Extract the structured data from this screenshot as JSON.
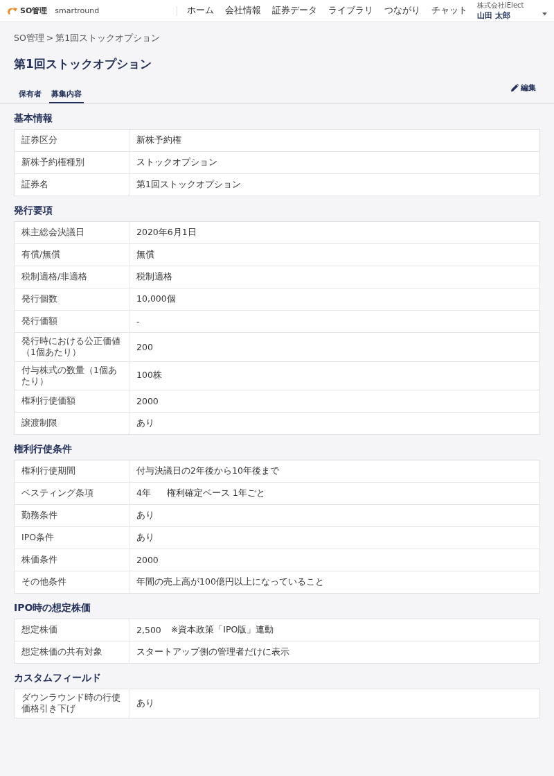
{
  "header": {
    "product": "SO管理",
    "brand": "smartround",
    "nav": [
      {
        "label": "ホーム"
      },
      {
        "label": "会社情報"
      },
      {
        "label": "証券データ"
      },
      {
        "label": "ライブラリ"
      },
      {
        "label": "つながり"
      },
      {
        "label": "チャット"
      }
    ],
    "user": {
      "company": "株式会社iElect",
      "name": "山田 太郎"
    }
  },
  "breadcrumb": {
    "items": [
      "SO管理",
      "第1回ストックオプション"
    ],
    "separator": ">"
  },
  "page_title": "第1回ストックオプション",
  "tabs": [
    {
      "label": "保有者",
      "selected": false
    },
    {
      "label": "募集内容",
      "selected": true
    }
  ],
  "edit_button": "編集",
  "sections": [
    {
      "title": "基本情報",
      "rows": [
        {
          "label": "証券区分",
          "value": [
            "新株予約権"
          ]
        },
        {
          "label": "新株予約権種別",
          "value": [
            "ストックオプション"
          ]
        },
        {
          "label": "証券名",
          "value": [
            "第1回ストックオプション"
          ]
        }
      ]
    },
    {
      "title": "発行要項",
      "rows": [
        {
          "label": "株主総会決議日",
          "value": [
            "2020年6月1日"
          ]
        },
        {
          "label": "有償/無償",
          "value": [
            "無償"
          ]
        },
        {
          "label": "税制適格/非適格",
          "value": [
            "税制適格"
          ]
        },
        {
          "label": "発行個数",
          "value": [
            "10,000個"
          ]
        },
        {
          "label": "発行価額",
          "value": [
            "-"
          ]
        },
        {
          "label": "発行時における公正価値（1個あたり）",
          "value": [
            "200"
          ]
        },
        {
          "label": "付与株式の数量（1個あたり）",
          "value": [
            "100株"
          ]
        },
        {
          "label": "権利行使価額",
          "value": [
            "2000"
          ]
        },
        {
          "label": "譲渡制限",
          "value": [
            "あり"
          ]
        }
      ]
    },
    {
      "title": "権利行使条件",
      "rows": [
        {
          "label": "権利行使期間",
          "value": [
            "付与決議日の2年後から10年後まで"
          ]
        },
        {
          "label": "ベスティング条項",
          "value": [
            "4年",
            "権利確定ベース 1年ごと"
          ]
        },
        {
          "label": "勤務条件",
          "value": [
            "あり"
          ]
        },
        {
          "label": "IPO条件",
          "value": [
            "あり"
          ]
        },
        {
          "label": "株価条件",
          "value": [
            "2000"
          ]
        },
        {
          "label": "その他条件",
          "value": [
            "年間の売上高が100億円以上になっていること"
          ]
        }
      ]
    },
    {
      "title": "IPO時の想定株価",
      "rows": [
        {
          "label": "想定株価",
          "value": [
            "2,500",
            "※資本政策「IPO版」連動"
          ]
        },
        {
          "label": "想定株価の共有対象",
          "value": [
            "スタートアップ側の管理者だけに表示"
          ]
        }
      ]
    },
    {
      "title": "カスタムフィールド",
      "rows": [
        {
          "label": "ダウンラウンド時の行使価格引き下げ",
          "value": [
            "あり"
          ]
        }
      ]
    }
  ]
}
